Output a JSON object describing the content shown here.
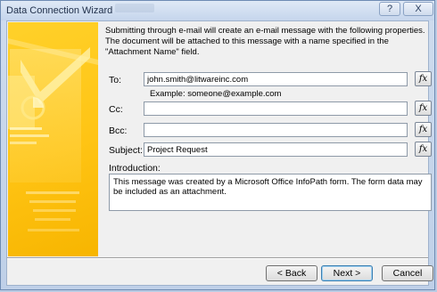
{
  "window": {
    "title": "Data Connection Wizard",
    "help_button": "?",
    "close_button": "X"
  },
  "description": "Submitting through e-mail will create an e-mail message with the following properties. The document will be attached to this message with a name specified in the \"Attachment Name\" field.",
  "fields": {
    "to": {
      "label": "To:",
      "value": "john.smith@litwareinc.com"
    },
    "example": "Example: someone@example.com",
    "cc": {
      "label": "Cc:",
      "value": ""
    },
    "bcc": {
      "label": "Bcc:",
      "value": ""
    },
    "subject": {
      "label": "Subject:",
      "value": "Project Request"
    },
    "formula_button": "fx"
  },
  "introduction": {
    "label": "Introduction:",
    "value": "This message was created by a Microsoft Office InfoPath form. The form data may be included as an attachment."
  },
  "buttons": {
    "back": "< Back",
    "next": "Next >",
    "cancel": "Cancel"
  },
  "colors": {
    "side_panel": "#ffc414",
    "title_bar": "#c5d5ec"
  }
}
